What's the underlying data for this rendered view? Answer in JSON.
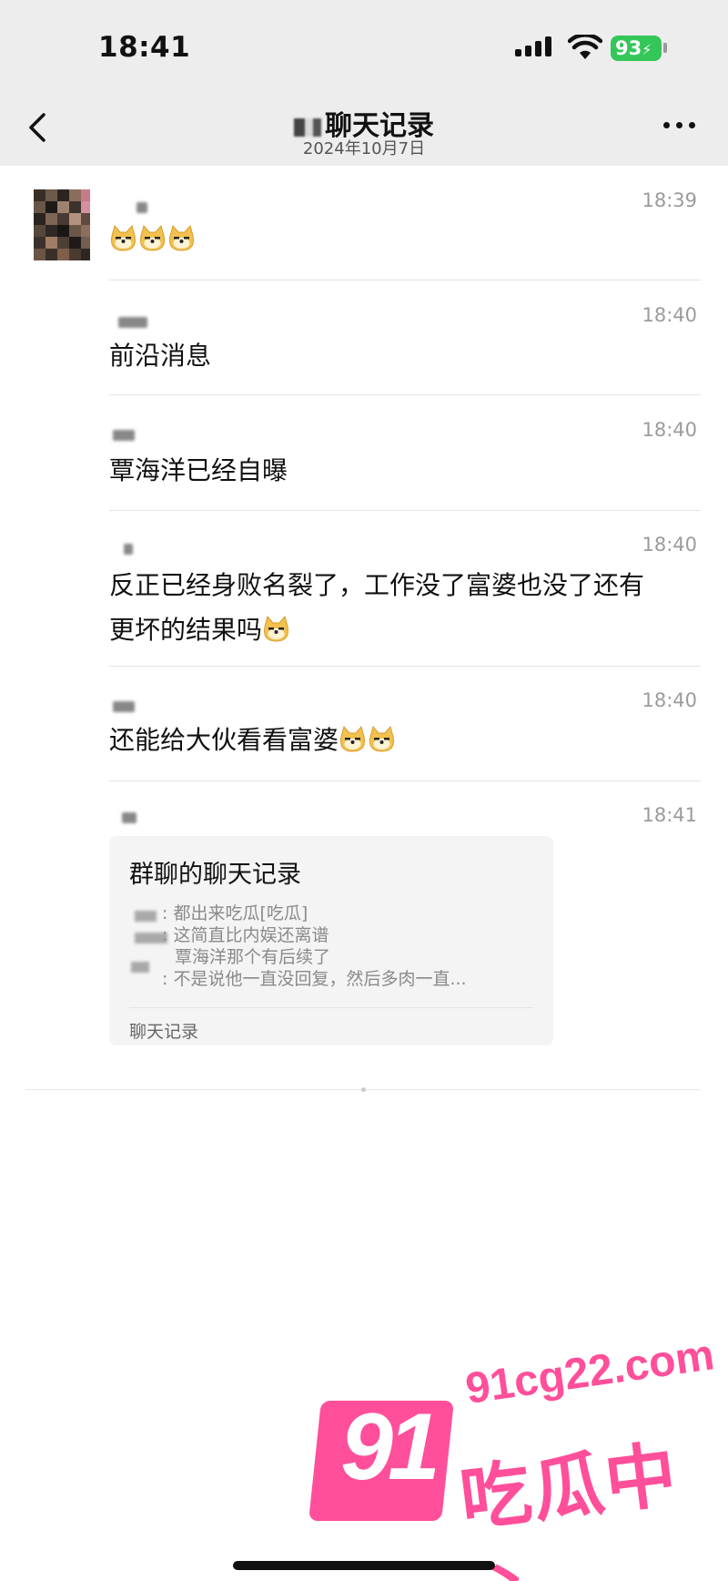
{
  "status_bar": {
    "time": "18:41",
    "battery": "93"
  },
  "nav": {
    "title": "聊天记录",
    "date": "2024年10月7日"
  },
  "messages": [
    {
      "time": "18:39",
      "text": ""
    },
    {
      "time": "18:40",
      "text": "前沿消息"
    },
    {
      "time": "18:40",
      "text": "覃海洋已经自曝"
    },
    {
      "time": "18:40",
      "text_line1": "反正已经身败名裂了，工作没了富婆也没了还有",
      "text_line2": "更坏的结果吗"
    },
    {
      "time": "18:40",
      "text": "还能给大伙看看富婆"
    },
    {
      "time": "18:41"
    }
  ],
  "record_card": {
    "title": "群聊的聊天记录",
    "lines": [
      ": 都出来吃瓜[吃瓜]",
      ": 这简直比内娱还离谱",
      "覃海洋那个有后续了",
      ": 不是说他一直没回复，然后多肉一直..."
    ],
    "footer": "聊天记录"
  },
  "watermark": {
    "number": "91",
    "url": "91cg22.com",
    "name": "吃瓜中心"
  },
  "colors": {
    "accent": "#ff4f9a",
    "battery": "#35c659",
    "header_bg": "#ededed"
  }
}
